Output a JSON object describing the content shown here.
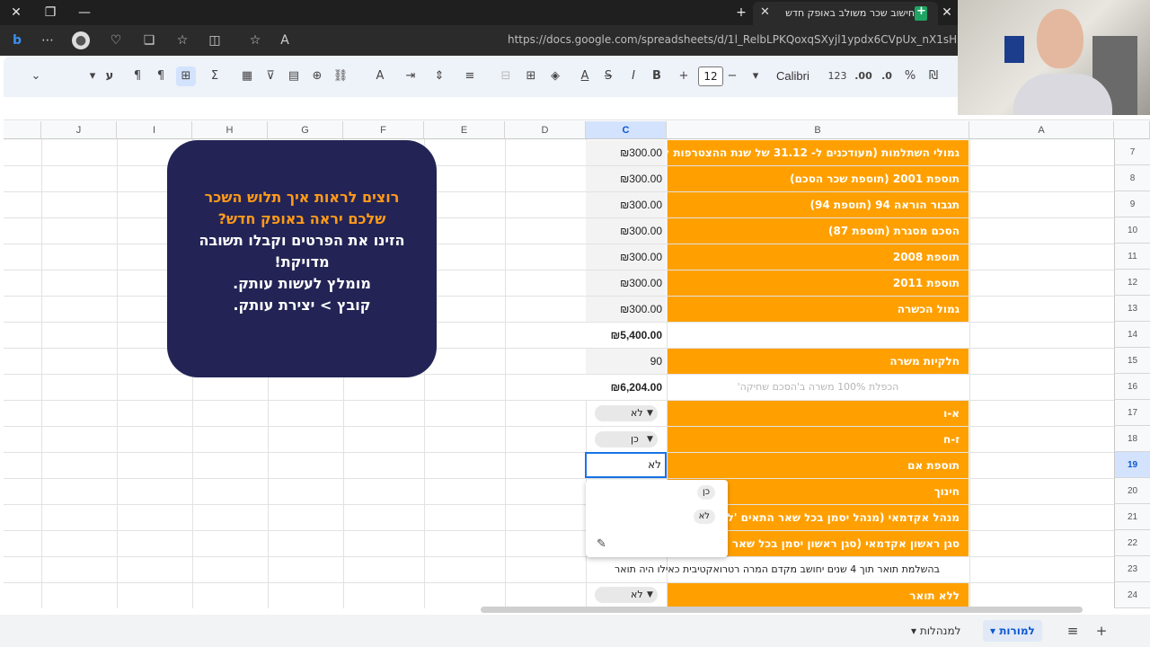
{
  "browser": {
    "tab_title": "חישוב שכר משולב באופק חדש",
    "url": "https://docs.google.com/spreadsheets/d/1l_RelbLPKQoxqSXyjl1ypdx6CVpUx_nX1sHfbdirZmE/edit"
  },
  "toolbar": {
    "font_size": "12",
    "font_name": "Calibri",
    "format_number": "123",
    "decimal_more": ".00",
    "decimal_less": ".0",
    "percent": "%",
    "currency": "₪"
  },
  "columns": [
    "J",
    "I",
    "H",
    "G",
    "F",
    "E",
    "D",
    "C",
    "B",
    "A"
  ],
  "rows": [
    {
      "num": "7",
      "b": "גמולי השתלמות (מעודכנים ל- 31.12 של שנת ההצטרפות לרפורמה)",
      "c": "₪300.00"
    },
    {
      "num": "8",
      "b": "תוספת 2001 (תוספת שכר הסכם)",
      "c": "₪300.00"
    },
    {
      "num": "9",
      "b": "תגבור הוראה 94 (תוספת 94)",
      "c": "₪300.00"
    },
    {
      "num": "10",
      "b": "הסכם מסגרת (תוספת 87)",
      "c": "₪300.00"
    },
    {
      "num": "11",
      "b": "תוספת 2008",
      "c": "₪300.00"
    },
    {
      "num": "12",
      "b": "תוספת 2011",
      "c": "₪300.00"
    },
    {
      "num": "13",
      "b": "גמול הכשרה",
      "c": "₪300.00"
    },
    {
      "num": "14",
      "b": "",
      "c": "₪5,400.00"
    },
    {
      "num": "15",
      "b": "חלקיות משרה",
      "c": "90"
    },
    {
      "num": "16",
      "b": "הכפלת 100% משרה ב'הסכם שחיקה'",
      "c": "₪6,204.00"
    },
    {
      "num": "17",
      "b": "א-ו",
      "c": "לא"
    },
    {
      "num": "18",
      "b": "ז-ח",
      "c": "כן"
    },
    {
      "num": "19",
      "b": "תוספת אם",
      "c": "לא"
    },
    {
      "num": "20",
      "b": "חינוך",
      "c": ""
    },
    {
      "num": "21",
      "b": "מנהל אקדמאי (מנהל יסמן בכל שאר התאים 'לא')",
      "c": ""
    },
    {
      "num": "22",
      "b": "סגן ראשון אקדמאי (סגן ראשון יסמן בכל שאר התאים 'לא')",
      "c": ""
    },
    {
      "num": "23",
      "b": "בהשלמת תואר תוך 4 שנים יחושב מקדם המרה רטרואקטיבית כאילו היה תואר",
      "c": ""
    },
    {
      "num": "24",
      "b": "ללא תואר",
      "c": "לא"
    }
  ],
  "dropdown": {
    "options": [
      "כן",
      "לא"
    ]
  },
  "promo": {
    "line1": "רוצים לראות איך תלוש השכר",
    "line2": "שלכם יראה באופק חדש?",
    "line3": "הזינו את הפרטים וקבלו תשובה",
    "line4": "מדויקת!",
    "line5": "מומלץ לעשות עותק.",
    "line6": "קובץ > יצירת עותק."
  },
  "sheets": {
    "active": "למורות",
    "other": "למנהלות"
  },
  "colors": {
    "accent_orange": "#ffa000",
    "promo_bg": "#232455",
    "promo_orange_text": "#ff9a1a",
    "selection_blue": "#1a73e8"
  }
}
